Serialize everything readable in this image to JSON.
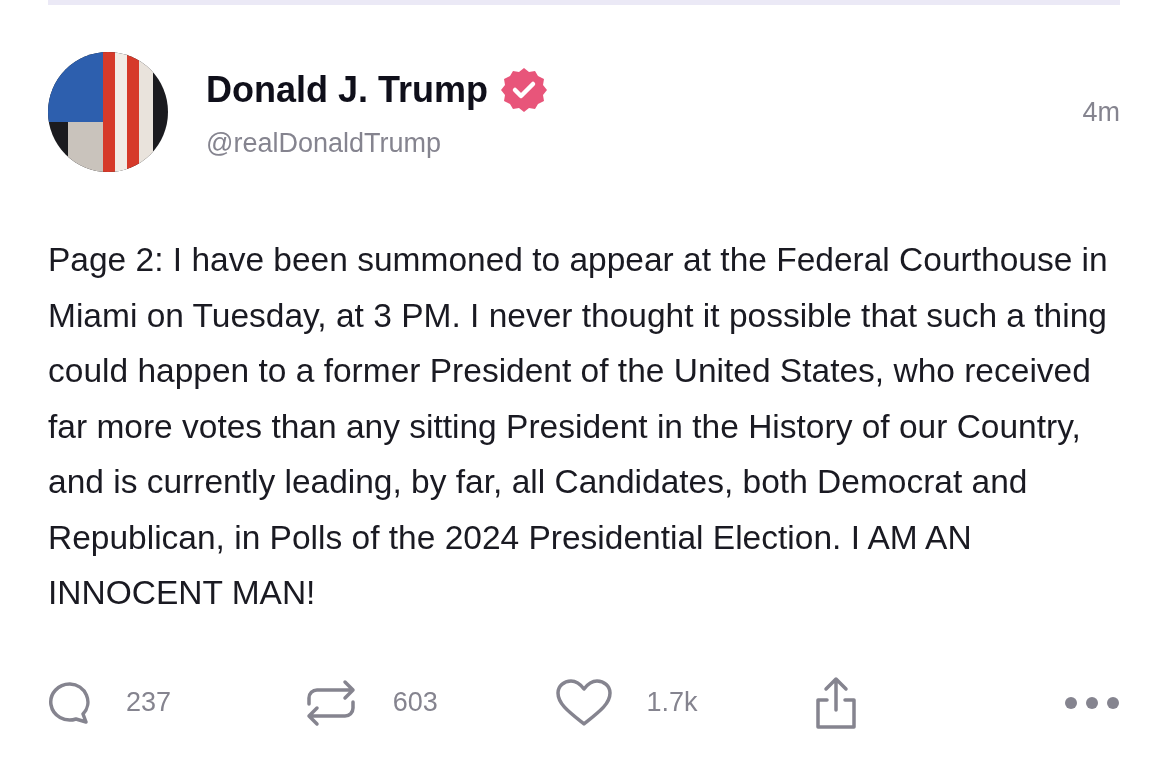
{
  "post": {
    "author": {
      "name": "Donald J. Trump",
      "verified": true,
      "handle": "@realDonaldTrump"
    },
    "time": "4m",
    "text": "Page 2: I have been summoned to appear at the Federal Courthouse in Miami on Tuesday, at 3 PM. I never thought it possible that such a thing could happen to a former President of the United States, who received far more votes than any sitting President in the History of our Country, and is currently leading, by far, all Candidates, both Democrat and Republican, in Polls of the 2024 Presidential Election. I AM AN INNOCENT MAN!"
  },
  "actions": [
    {
      "kind": "reply",
      "count": "237"
    },
    {
      "kind": "repost",
      "count": "603"
    },
    {
      "kind": "like",
      "count": "1.7k"
    },
    {
      "kind": "share"
    },
    {
      "kind": "more"
    }
  ]
}
